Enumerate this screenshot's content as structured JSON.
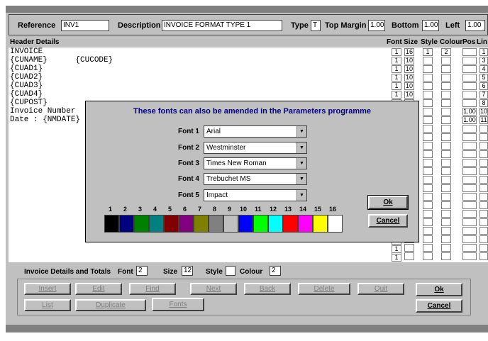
{
  "header": {
    "reference_label": "Reference",
    "reference_value": "INV1",
    "description_label": "Description",
    "description_value": "INVOICE FORMAT TYPE 1",
    "type_label": "Type",
    "type_value": "T",
    "top_margin_label": "Top Margin",
    "top_margin_value": "1.00",
    "bottom_label": "Bottom",
    "bottom_value": "1.00",
    "left_label": "Left",
    "left_value": "1.00"
  },
  "header_details": {
    "title": "Header Details",
    "columns": [
      "Font",
      "Size",
      "Style",
      "Colour",
      "Pos",
      "Lin"
    ],
    "lines": [
      "INVOICE",
      "{CUNAME}      {CUCODE}",
      "{CUAD1}",
      "{CUAD2}",
      "{CUAD3}",
      "{CUAD4}",
      "{CUPOST}",
      "Invoice Number",
      "Date : {NMDATE}"
    ],
    "rows": [
      {
        "font": "1",
        "size": "16",
        "style": "1",
        "colour": "2",
        "pos": "",
        "lin": "1"
      },
      {
        "font": "1",
        "size": "10",
        "style": "",
        "colour": "",
        "pos": "",
        "lin": "3"
      },
      {
        "font": "1",
        "size": "10",
        "style": "",
        "colour": "",
        "pos": "",
        "lin": "4"
      },
      {
        "font": "1",
        "size": "10",
        "style": "",
        "colour": "",
        "pos": "",
        "lin": "5"
      },
      {
        "font": "1",
        "size": "10",
        "style": "",
        "colour": "",
        "pos": "",
        "lin": "6"
      },
      {
        "font": "1",
        "size": "10",
        "style": "",
        "colour": "",
        "pos": "",
        "lin": "7"
      },
      {
        "font": "",
        "size": "",
        "style": "",
        "colour": "",
        "pos": "",
        "lin": "8"
      },
      {
        "font": "",
        "size": "",
        "style": "",
        "colour": "",
        "pos": "1.00",
        "lin": "10"
      },
      {
        "font": "",
        "size": "",
        "style": "",
        "colour": "",
        "pos": "1.00",
        "lin": "11"
      }
    ],
    "extra_font_rows": [
      "1",
      "1",
      "1"
    ]
  },
  "dialog": {
    "title": "These fonts can also be amended in the Parameters programme",
    "fonts": [
      {
        "label": "Font 1",
        "value": "Arial"
      },
      {
        "label": "Font 2",
        "value": "Westminster"
      },
      {
        "label": "Font 3",
        "value": "Times New Roman"
      },
      {
        "label": "Font 4",
        "value": "Trebuchet MS"
      },
      {
        "label": "Font 5",
        "value": "Impact"
      }
    ],
    "colour_numbers": [
      "1",
      "2",
      "3",
      "4",
      "5",
      "6",
      "7",
      "8",
      "9",
      "10",
      "11",
      "12",
      "13",
      "14",
      "15",
      "16"
    ],
    "colours": [
      "#000000",
      "#000080",
      "#008000",
      "#008080",
      "#800000",
      "#800080",
      "#808000",
      "#808080",
      "#c0c0c0",
      "#0000ff",
      "#00ff00",
      "#00ffff",
      "#ff0000",
      "#ff00ff",
      "#ffff00",
      "#ffffff"
    ],
    "ok_label": "Ok",
    "cancel_label": "Cancel"
  },
  "totals": {
    "label": "Invoice Details and Totals",
    "font_label": "Font",
    "font_value": "2",
    "size_label": "Size",
    "size_value": "12",
    "style_label": "Style",
    "style_value": "",
    "colour_label": "Colour",
    "colour_value": "2"
  },
  "buttons": {
    "insert": "Insert",
    "edit": "Edit",
    "find": "Find",
    "next": "Next",
    "back": "Back",
    "delete": "Delete",
    "quit": "Quit",
    "ok": "Ok",
    "list": "List",
    "duplicate": "Duplicate",
    "fonts": "Fonts",
    "cancel": "Cancel"
  }
}
